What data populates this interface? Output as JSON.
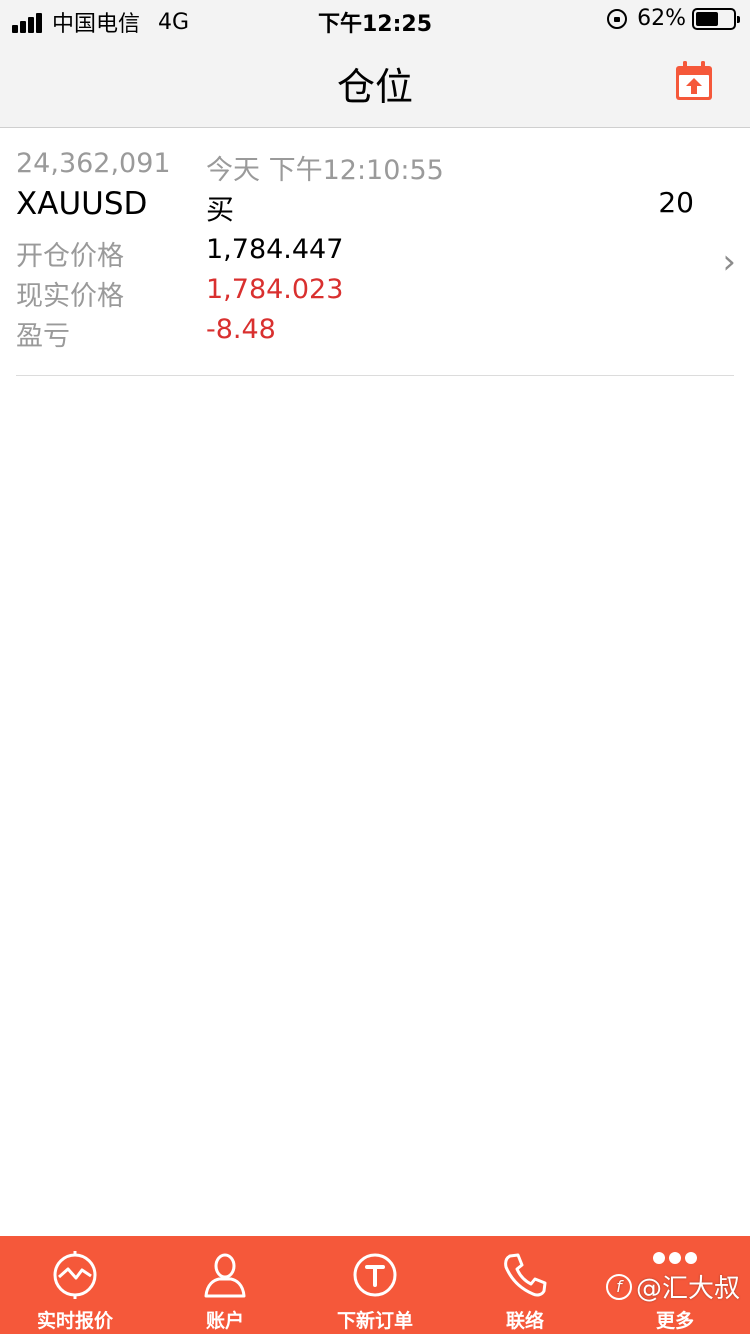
{
  "status_bar": {
    "carrier": "中国电信",
    "network": "4G",
    "time": "下午12:25",
    "battery": "62%",
    "battery_level": 0.62
  },
  "header": {
    "title": "仓位",
    "calendar_icon": "calendar-upload-icon",
    "accent_color": "#f5583a"
  },
  "position": {
    "order_id": "24,362,091",
    "timestamp": "今天 下午12:10:55",
    "symbol": "XAUUSD",
    "side": "买",
    "quantity": "20",
    "open_price_label": "开仓价格",
    "open_price": "1,784.447",
    "current_price_label": "现实价格",
    "current_price": "1,784.023",
    "pnl_label": "盈亏",
    "pnl": "-8.48",
    "loss_color": "#d9302f",
    "chevron": "›"
  },
  "tabs": [
    {
      "label": "实时报价",
      "icon": "quote-chart-icon"
    },
    {
      "label": "账户",
      "icon": "user-icon"
    },
    {
      "label": "下新订单",
      "icon": "trade-t-icon"
    },
    {
      "label": "联络",
      "icon": "phone-icon"
    },
    {
      "label": "更多",
      "icon": "more-dots-icon"
    }
  ],
  "watermark": {
    "text": "@汇大叔"
  }
}
